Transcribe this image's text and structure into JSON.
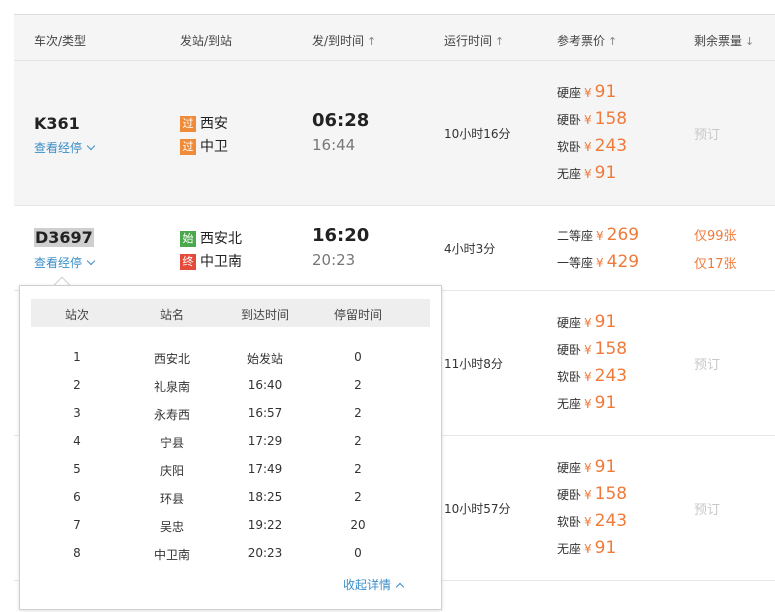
{
  "header": {
    "col_train": "车次/类型",
    "col_station": "发站/到站",
    "col_time": "发/到时间",
    "col_duration": "运行时间",
    "col_price": "参考票价",
    "col_remain": "剩余票量",
    "sort_up": "↑",
    "sort_down": "↓"
  },
  "rows": [
    {
      "train": "K361",
      "stops_link": "查看经停",
      "from_badge": "过",
      "from": "西安",
      "to_badge": "过",
      "to": "中卫",
      "depart": "06:28",
      "arrive": "16:44",
      "duration": "10小时16分",
      "prices": [
        {
          "seat": "硬座",
          "yen": "¥",
          "value": "91"
        },
        {
          "seat": "硬卧",
          "yen": "¥",
          "value": "158"
        },
        {
          "seat": "软卧",
          "yen": "¥",
          "value": "243"
        },
        {
          "seat": "无座",
          "yen": "¥",
          "value": "91"
        }
      ],
      "book": "预订"
    },
    {
      "train": "D3697",
      "stops_link": "查看经停",
      "from_badge": "始",
      "from": "西安北",
      "to_badge": "终",
      "to": "中卫南",
      "depart": "16:20",
      "arrive": "20:23",
      "duration": "4小时3分",
      "prices": [
        {
          "seat": "二等座",
          "yen": "¥",
          "value": "269"
        },
        {
          "seat": "一等座",
          "yen": "¥",
          "value": "429"
        }
      ],
      "remain": [
        "仅99张",
        "仅17张"
      ]
    },
    {
      "duration": "11小时8分",
      "prices": [
        {
          "seat": "硬座",
          "yen": "¥",
          "value": "91"
        },
        {
          "seat": "硬卧",
          "yen": "¥",
          "value": "158"
        },
        {
          "seat": "软卧",
          "yen": "¥",
          "value": "243"
        },
        {
          "seat": "无座",
          "yen": "¥",
          "value": "91"
        }
      ],
      "book": "预订"
    },
    {
      "duration": "10小时57分",
      "prices": [
        {
          "seat": "硬座",
          "yen": "¥",
          "value": "91"
        },
        {
          "seat": "硬卧",
          "yen": "¥",
          "value": "158"
        },
        {
          "seat": "软卧",
          "yen": "¥",
          "value": "243"
        },
        {
          "seat": "无座",
          "yen": "¥",
          "value": "91"
        }
      ],
      "book": "预订"
    }
  ],
  "popup": {
    "head": [
      "站次",
      "站名",
      "到达时间",
      "停留时间"
    ],
    "stops": [
      [
        "1",
        "西安北",
        "始发站",
        "0"
      ],
      [
        "2",
        "礼泉南",
        "16:40",
        "2"
      ],
      [
        "3",
        "永寿西",
        "16:57",
        "2"
      ],
      [
        "4",
        "宁县",
        "17:29",
        "2"
      ],
      [
        "5",
        "庆阳",
        "17:49",
        "2"
      ],
      [
        "6",
        "环县",
        "18:25",
        "2"
      ],
      [
        "7",
        "吴忠",
        "19:22",
        "20"
      ],
      [
        "8",
        "中卫南",
        "20:23",
        "0"
      ]
    ],
    "collapse": "收起详情"
  },
  "colors": {
    "accent_link": "#3a8ec8",
    "price": "#f07a3a",
    "badge_pass": "#f08b3a",
    "badge_start": "#4ca84c",
    "badge_end": "#e64a3a"
  }
}
